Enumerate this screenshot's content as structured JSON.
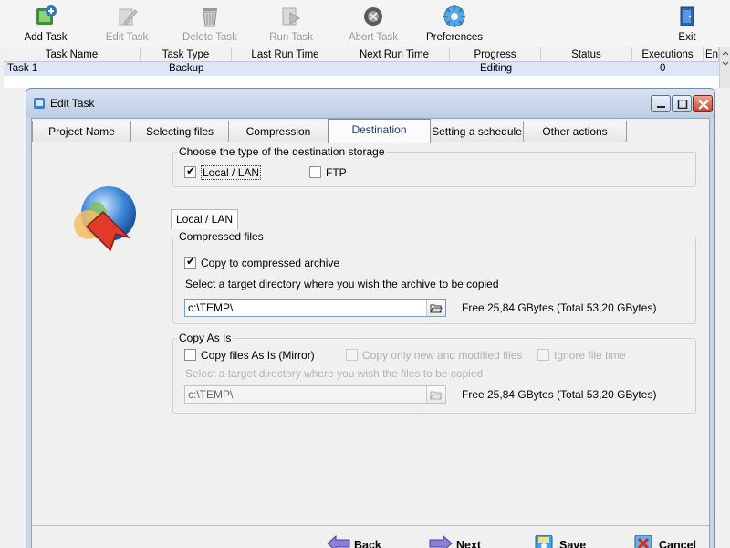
{
  "toolbar": {
    "buttons": [
      {
        "label": "Add Task",
        "icon": "add-task-icon",
        "enabled": true
      },
      {
        "label": "Edit Task",
        "icon": "edit-task-icon",
        "enabled": false
      },
      {
        "label": "Delete Task",
        "icon": "delete-task-icon",
        "enabled": false
      },
      {
        "label": "Run Task",
        "icon": "run-task-icon",
        "enabled": false
      },
      {
        "label": "Abort Task",
        "icon": "abort-task-icon",
        "enabled": false
      },
      {
        "label": "Preferences",
        "icon": "preferences-icon",
        "enabled": true
      },
      {
        "label": "Exit",
        "icon": "exit-icon",
        "enabled": true
      }
    ]
  },
  "grid": {
    "columns": [
      "Task Name",
      "Task Type",
      "Last Run Time",
      "Next Run Time",
      "Progress",
      "Status",
      "Executions",
      "Ena"
    ],
    "rows": [
      {
        "task_name": "Task 1",
        "task_type": "Backup",
        "last_run": "",
        "next_run": "",
        "progress": "Editing",
        "status": "",
        "executions": "0",
        "enabled": ""
      }
    ]
  },
  "dialog": {
    "title": "Edit Task",
    "tabs": [
      "Project Name",
      "Selecting files",
      "Compression",
      "Destination",
      "Setting a schedule",
      "Other actions"
    ],
    "active_tab": "Destination",
    "storage_group": {
      "legend": "Choose the type of the destination storage",
      "local_lan": {
        "label": "Local / LAN",
        "checked": true
      },
      "ftp": {
        "label": "FTP",
        "checked": false
      }
    },
    "subtab_label": "Local / LAN",
    "compressed_group": {
      "legend": "Compressed files",
      "copy_to_archive": {
        "label": "Copy to compressed archive",
        "checked": true
      },
      "prompt": "Select a target directory where you wish the archive to be copied",
      "path": "c:\\TEMP\\",
      "free_space": "Free 25,84 GBytes (Total 53,20 GBytes)"
    },
    "copyasis_group": {
      "legend": "Copy As Is",
      "mirror": {
        "label": "Copy files As Is (Mirror)",
        "checked": false
      },
      "only_new": {
        "label": "Copy only new and modified files",
        "checked": false
      },
      "ignore_time": {
        "label": "Ignore file time",
        "checked": false
      },
      "prompt": "Select a target directory where you wish the files to be copied",
      "path": "c:\\TEMP\\",
      "free_space": "Free 25,84 GBytes (Total 53,20 GBytes)"
    },
    "buttons": {
      "back": "Back",
      "next": "Next",
      "save": "Save",
      "cancel": "Cancel"
    }
  },
  "colors": {
    "accent": "#1a3a7a",
    "selected_row": "#dde6f6",
    "close_button": "#c8432b"
  }
}
